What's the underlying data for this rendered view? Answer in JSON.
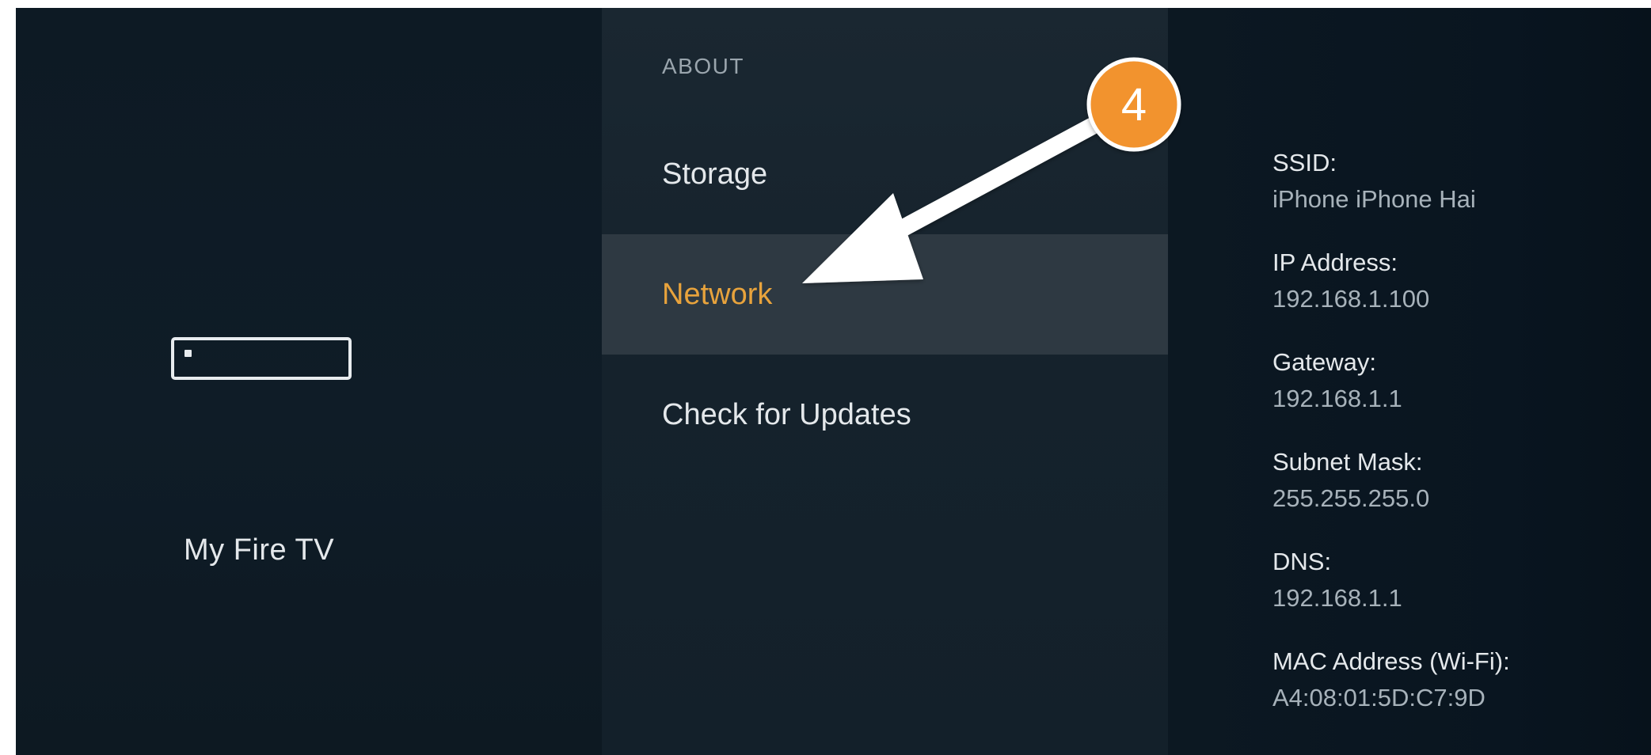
{
  "device": {
    "name": "My Fire TV",
    "icon": "fire-tv-stick-icon"
  },
  "menu": {
    "section_label": "ABOUT",
    "items": [
      {
        "label": "Storage",
        "selected": false
      },
      {
        "label": "Network",
        "selected": true
      },
      {
        "label": "Check for Updates",
        "selected": false
      }
    ]
  },
  "network_info": [
    {
      "label": "SSID:",
      "value": "iPhone iPhone Hai"
    },
    {
      "label": "IP Address:",
      "value": "192.168.1.100"
    },
    {
      "label": "Gateway:",
      "value": "192.168.1.1"
    },
    {
      "label": "Subnet Mask:",
      "value": "255.255.255.0"
    },
    {
      "label": "DNS:",
      "value": "192.168.1.1"
    },
    {
      "label": "MAC Address (Wi-Fi):",
      "value": "A4:08:01:5D:C7:9D"
    }
  ],
  "annotation": {
    "step_number": "4",
    "badge_color": "#f2932e",
    "arrow_color": "#ffffff"
  },
  "colors": {
    "background": "#0e1b25",
    "selected_text": "#e8a33c",
    "selected_background": "#2e3942"
  }
}
